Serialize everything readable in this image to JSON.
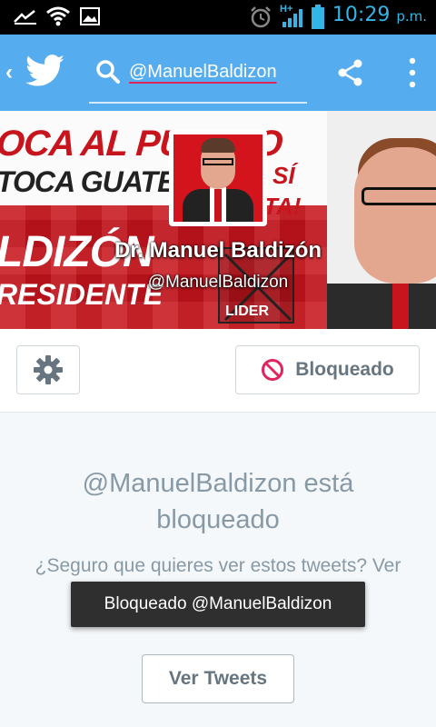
{
  "status_bar": {
    "time": "10:29",
    "ampm": "p.m.",
    "network_type": "H+",
    "icons": [
      "missed-call-icon",
      "wifi-icon",
      "image-icon",
      "alarm-icon",
      "signal-icon",
      "battery-icon"
    ]
  },
  "action_bar": {
    "search_query": "@ManuelBaldizon",
    "icons": [
      "back-chevron-icon",
      "twitter-bird-icon",
      "search-icon",
      "share-icon",
      "overflow-menu-icon"
    ],
    "color": "#55acee"
  },
  "banner": {
    "slogan_line1": "OCA AL PUEBLO",
    "slogan_line2": "TOCA GUATEM",
    "slogan_right": "SÍ",
    "slogan_right2": "TA!",
    "name_fragment": "LDIZÓN",
    "role_fragment": "RESIDENTE",
    "ballot_label": "LIDER",
    "brand_red": "#c8141c"
  },
  "profile": {
    "name": "Dr. Manuel Baldizón",
    "handle": "@ManuelBaldizon"
  },
  "buttons": {
    "blocked_label": "Bloqueado",
    "view_tweets_label": "Ver Tweets"
  },
  "blocked_notice": {
    "title": "@ManuelBaldizon está bloqueado",
    "description": "¿Seguro que quieres ver estos tweets? Ver los tweets no desbloqueará a @ManuelBaldizon"
  },
  "toast": {
    "message": "Bloqueado @ManuelBaldizon"
  }
}
